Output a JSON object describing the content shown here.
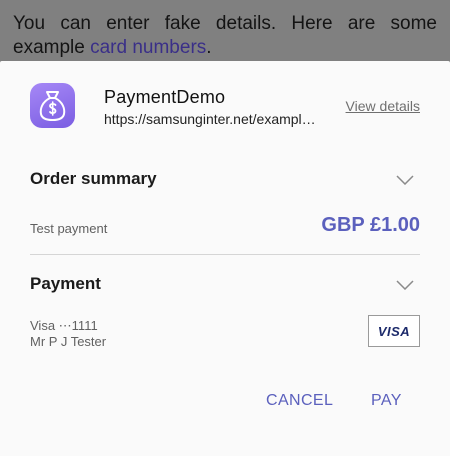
{
  "background_page": {
    "text_before_link": "You can enter fake details. Here are some example ",
    "link_text": "card numbers",
    "text_after_link": "."
  },
  "sheet": {
    "app_name": "PaymentDemo",
    "app_url": "https://samsunginter.net/example/payment-request",
    "view_details": "View details",
    "order_summary": {
      "title": "Order summary",
      "item_label": "Test payment",
      "amount": "GBP £1.00"
    },
    "payment": {
      "title": "Payment",
      "card": "Visa ⋯1111",
      "cardholder": "Mr P J Tester",
      "card_brand": "VISA"
    },
    "actions": {
      "cancel": "CANCEL",
      "pay": "PAY"
    },
    "accent_color": "#5b60bd",
    "icon_color": "#8a6cee"
  }
}
